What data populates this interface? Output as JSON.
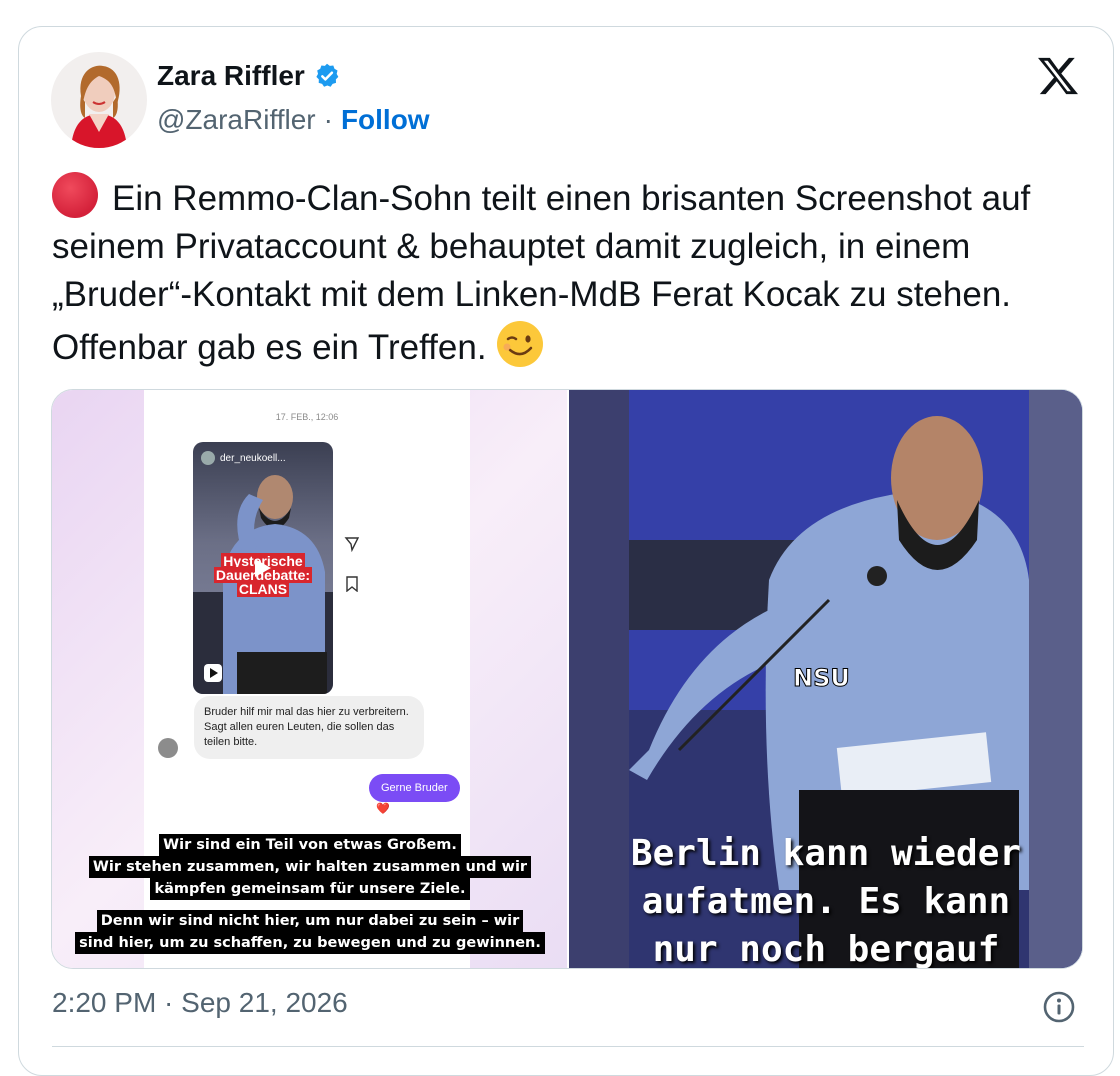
{
  "author": {
    "display_name": "Zara Riffler",
    "handle": "@ZaraRiffler",
    "separator": "·",
    "follow_label": "Follow",
    "verified_icon": "verified-badge-icon",
    "verified_color": "#1d9bf0"
  },
  "tweet": {
    "text_main": "Ein Remmo-Clan-Sohn teilt einen brisanten Screenshot auf seinem Privataccount  & behauptet damit zugleich, in einem  „Bruder“-Kontakt mit dem Linken-MdB Ferat Kocak zu stehen. Offenbar gab es ein Treffen.",
    "leading_icon": "red-circle-emoji",
    "trailing_icon": "winking-face-emoji",
    "timestamp": "2:20 PM · Sep 21, 2026"
  },
  "media_left": {
    "chat_date": "17. FEB., 12:06",
    "reel_user": "der_neukoell...",
    "reel_caption_lines": [
      "Hysterische",
      "Dauerdebatte:",
      "CLANS"
    ],
    "message_in": "Bruder hilf mir mal das hier zu verbreitern. Sagt allen euren Leuten, die sollen das teilen bitte.",
    "message_out": "Gerne Bruder",
    "reaction": "❤️",
    "subtitle_1": [
      "Wir sind ein Teil von etwas Großem.",
      "Wir stehen zusammen, wir halten zusammen und wir",
      "kämpfen gemeinsam für unsere Ziele."
    ],
    "subtitle_2": [
      "Denn wir sind nicht hier, um nur dabei zu sein – wir",
      "sind hier, um zu schaffen, zu bewegen und zu gewinnen."
    ]
  },
  "media_right": {
    "overlay_label": "NSU",
    "subtitle_lines": [
      "Berlin kann wieder",
      "aufatmen. Es kann",
      "nur noch bergauf"
    ]
  },
  "colors": {
    "text": "#0f1419",
    "secondary": "#536471",
    "link": "#006fd6",
    "border": "#cfd9de"
  }
}
